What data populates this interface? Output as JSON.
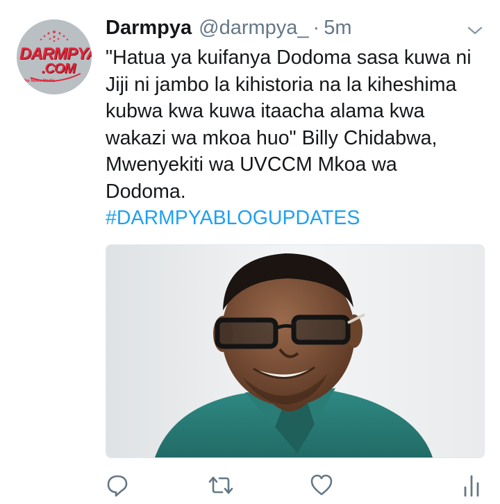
{
  "tweet": {
    "author": {
      "display_name": "Darmpya",
      "handle": "@darmpya_",
      "separator": "·",
      "timestamp": "5m",
      "avatar": {
        "logo_text_top": "DARMPYA",
        "logo_text_bottom": ".COM",
        "logo_subtext": "The News Media",
        "background": "#b9bfc3",
        "logo_color": "#e0263a"
      }
    },
    "text_lines": [
      "\"Hatua ya kuifanya Dodoma sasa kuwa ni",
      "Jiji ni jambo la kihistoria na la kiheshima",
      "kubwa kwa kuwa itaacha alama kwa",
      "wakazi wa mkoa huo\" Billy Chidabwa,",
      "Mwenyekiti wa UVCCM Mkoa wa",
      "Dodoma."
    ],
    "hashtag": "#DARMPYABLOGUPDATES",
    "media": {
      "description_icon": "photo-portrait"
    },
    "actions": {
      "reply_icon": "reply-icon",
      "retweet_icon": "retweet-icon",
      "like_icon": "like-icon",
      "analytics_icon": "analytics-icon"
    },
    "colors": {
      "text": "#14171a",
      "secondary": "#657786",
      "link": "#1da1f2"
    }
  }
}
